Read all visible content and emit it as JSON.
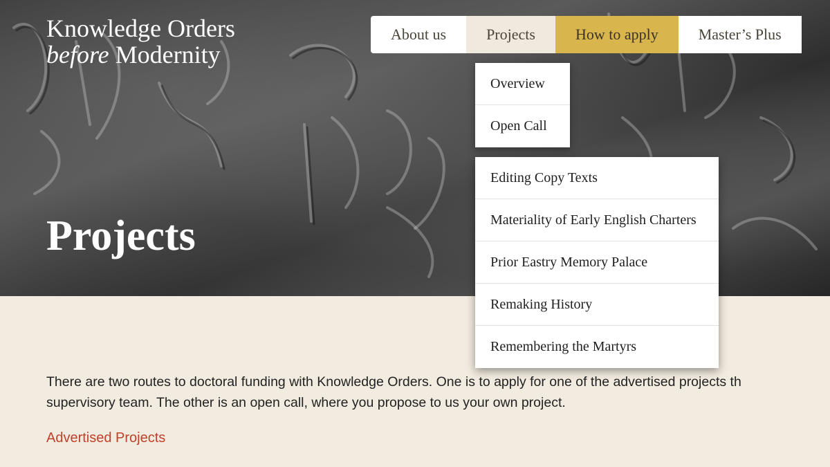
{
  "site": {
    "logo_line1": "Knowledge Orders",
    "logo_line2_italic": "before",
    "logo_line2_rest": "Modernity"
  },
  "nav": {
    "items": [
      {
        "label": "About us"
      },
      {
        "label": "Projects"
      },
      {
        "label": "How to apply"
      },
      {
        "label": "Master’s Plus"
      }
    ]
  },
  "dropdown_main": {
    "items": [
      {
        "label": "Overview"
      },
      {
        "label": "Open Call"
      }
    ]
  },
  "dropdown_projects": {
    "items": [
      {
        "label": "Editing Copy Texts"
      },
      {
        "label": "Materiality of Early English Charters"
      },
      {
        "label": "Prior Eastry Memory Palace"
      },
      {
        "label": "Remaking History"
      },
      {
        "label": "Remembering the Martyrs"
      }
    ]
  },
  "hero": {
    "title": "Projects"
  },
  "content": {
    "intro_line1": "There are two routes to doctoral funding with Knowledge Orders. One is to apply for one of the advertised projects th",
    "intro_line2": "supervisory team. The other is an open call, where you propose to us your own project.",
    "advertised_link": "Advertised Projects"
  },
  "colors": {
    "accent": "#d9b64d",
    "link": "#c0402a",
    "background": "#f2ebdf"
  }
}
